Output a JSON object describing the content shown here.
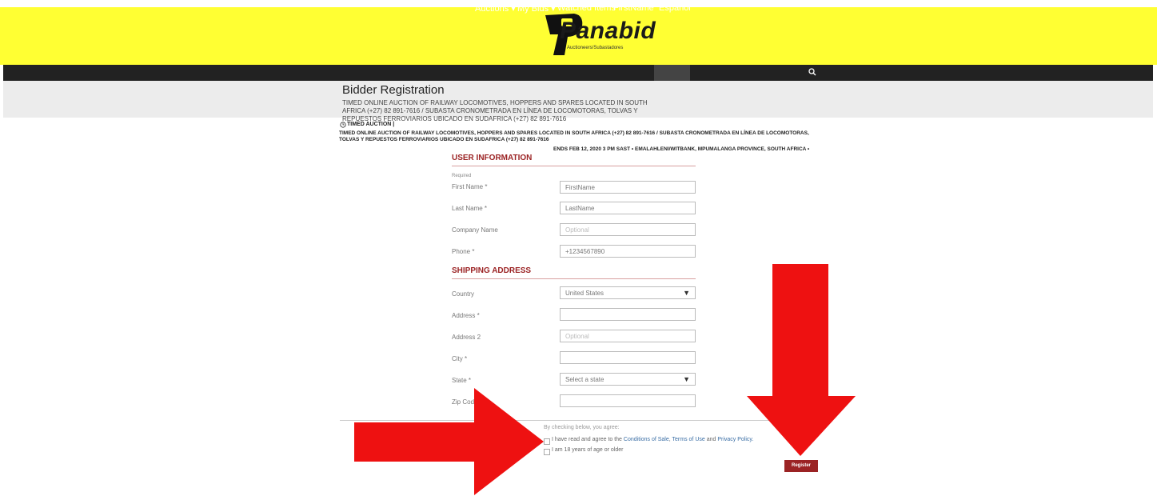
{
  "brand": {
    "logo_text": "Panabid",
    "logo_sub": "Auctioneers/Subastadores"
  },
  "nav": {
    "items": [
      {
        "label": "Auctions ▾"
      },
      {
        "label": "My Bids ▾"
      },
      {
        "label": "Watched Items"
      },
      {
        "label": "FirstName"
      },
      {
        "label": "Español"
      }
    ],
    "search_icon": "search-icon"
  },
  "header": {
    "title": "Bidder Registration",
    "subtitle": "TIMED ONLINE AUCTION OF RAILWAY LOCOMOTIVES, HOPPERS AND SPARES LOCATED IN SOUTH AFRICA (+27) 82 891-7616 / SUBASTA CRONOMETRADA EN LÍNEA DE LOCOMOTORAS, TOLVAS Y REPUESTOS FERROVIARIOS UBICADO EN SUDAFRICA (+27) 82 891-7616"
  },
  "auction": {
    "type_label": "TIMED AUCTION |",
    "description": "TIMED ONLINE AUCTION OF RAILWAY LOCOMOTIVES, HOPPERS AND SPARES LOCATED IN SOUTH AFRICA (+27) 82 891-7616 / SUBASTA CRONOMETRADA EN LÍNEA DE LOCOMOTORAS, TOLVAS Y REPUESTOS FERROVIARIOS UBICADO EN SUDAFRICA (+27) 82 891-7616",
    "ends": "ENDS FEB 12, 2020 3 PM SAST • EMALAHLENI/WITBANK, MPUMALANGA PROVINCE, SOUTH AFRICA •"
  },
  "user_info": {
    "title": "USER INFORMATION",
    "required": "Required",
    "fields": [
      {
        "label": "First Name *",
        "value": "FirstName",
        "placeholder": ""
      },
      {
        "label": "Last Name *",
        "value": "LastName",
        "placeholder": ""
      },
      {
        "label": "Company Name",
        "value": "",
        "placeholder": "Optional"
      },
      {
        "label": "Phone *",
        "value": "+1234567890",
        "placeholder": ""
      }
    ]
  },
  "shipping": {
    "title": "SHIPPING ADDRESS",
    "country_label": "Country",
    "country_value": "United States",
    "address_label": "Address *",
    "address2_label": "Address 2",
    "address2_placeholder": "Optional",
    "city_label": "City *",
    "state_label": "State *",
    "state_value": "Select a state",
    "zip_label": "Zip Code"
  },
  "agreement": {
    "intro": "By checking below, you agree:",
    "terms_prefix": "I have read and agree to the",
    "conditions_link": "Conditions of Sale",
    "sep1": ",",
    "terms_link": "Terms of Use",
    "and_text": "and",
    "privacy_link": "Privacy Policy.",
    "age_label": "I am 18 years of age or older"
  },
  "register_label": "Register",
  "colors": {
    "header_yellow": "#ffff33",
    "navbar": "#222222",
    "accent": "#9b2324",
    "arrow_red": "#ee1111"
  }
}
